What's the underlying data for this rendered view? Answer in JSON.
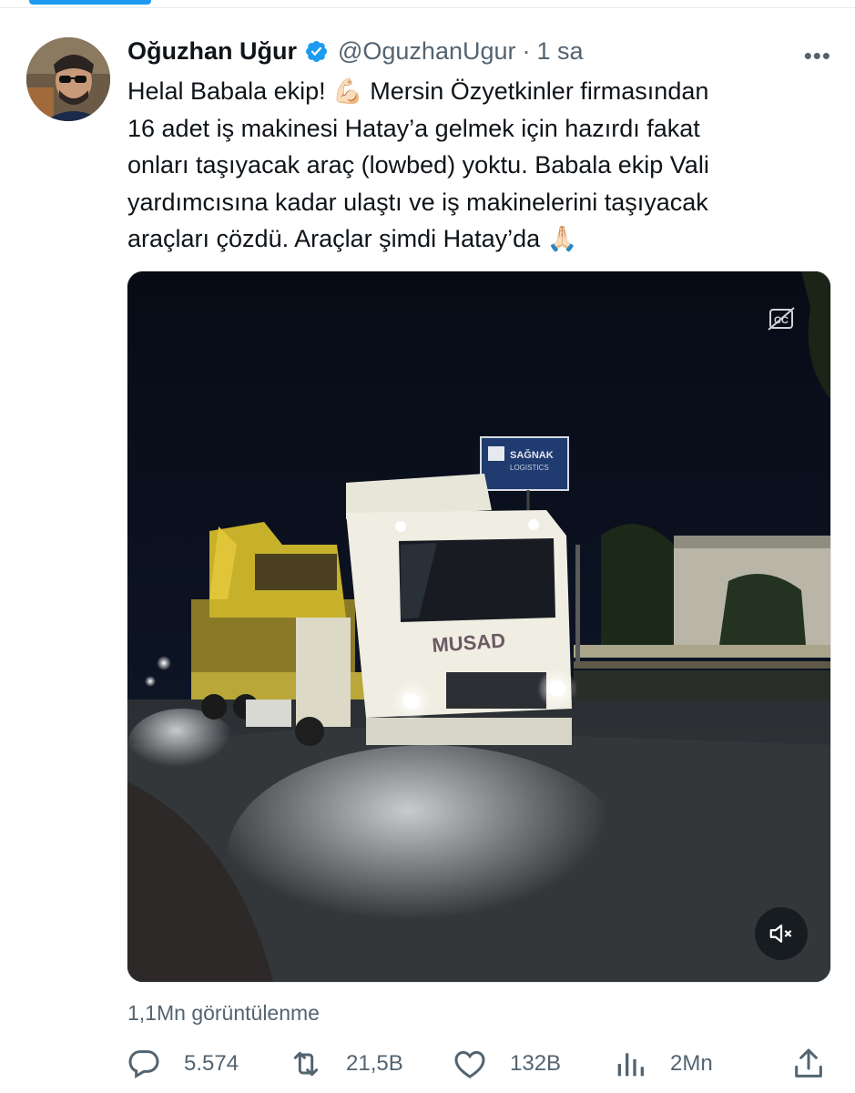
{
  "tweet": {
    "author_name": "Oğuzhan Uğur",
    "handle": "@OguzhanUgur",
    "separator": "·",
    "time": "1 sa",
    "more_label": "•••",
    "text": "Helal Babala ekip! 💪🏻 Mersin Özyetkinler firmasından\n16 adet iş makinesi Hatay’a gelmek için hazırdı fakat\nonları taşıyacak araç (lowbed) yoktu. Babala ekip Vali\nyardımcısına kadar ulaştı ve iş makinelerini taşıyacak\naraçları çözdü. Araçlar şimdi Hatay’da 🙏🏻",
    "views": "1,1Mn görüntülenme"
  },
  "media": {
    "type": "video",
    "sign_text_1": "SAĞNAK",
    "sign_text_2": "LOGISTICS",
    "truck_text": "MUSAD",
    "icons": [
      "closed-captions-icon",
      "mute-icon"
    ]
  },
  "actions": {
    "replies": "5.574",
    "retweets": "21,5B",
    "likes": "132B",
    "views": "2Mn"
  },
  "colors": {
    "accent": "#1d9bf0",
    "text_primary": "#0f1419",
    "text_secondary": "#536471"
  }
}
